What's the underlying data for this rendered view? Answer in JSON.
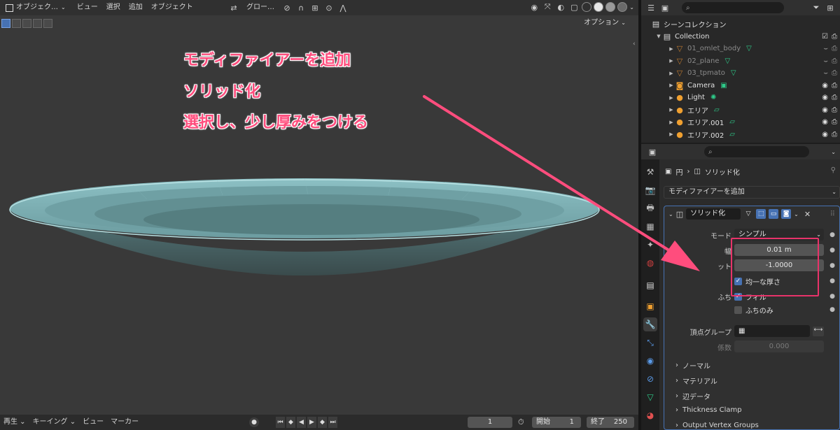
{
  "viewport": {
    "header": {
      "mode": "オブジェク…",
      "menu": [
        "ビュー",
        "選択",
        "追加",
        "オブジェクト"
      ],
      "transform": "グロー…"
    },
    "options": "オプション",
    "annotations": [
      "モディファイアーを追加",
      "ソリッド化",
      "選択し、少し厚みをつける"
    ]
  },
  "timeline": {
    "playback": "再生",
    "keying": "キーイング",
    "view": "ビュー",
    "marker": "マーカー",
    "current_frame": "1",
    "start_label": "開始",
    "start": "1",
    "end_label": "終了",
    "end": "250"
  },
  "outliner": {
    "scene_collection": "シーンコレクション",
    "collection": "Collection",
    "items": [
      {
        "name": "01_omlet_body",
        "dim": true
      },
      {
        "name": "02_plane",
        "dim": true
      },
      {
        "name": "03_tpmato",
        "dim": true
      },
      {
        "name": "Camera",
        "dim": false
      },
      {
        "name": "Light",
        "dim": false
      },
      {
        "name": "エリア",
        "dim": false
      },
      {
        "name": "エリア.001",
        "dim": false
      },
      {
        "name": "エリア.002",
        "dim": false
      }
    ]
  },
  "properties": {
    "breadcrumb_object": "円",
    "breadcrumb_modifier": "ソリッド化",
    "add_modifier": "モディファイアーを追加",
    "modifier": {
      "name": "ソリッド化",
      "mode_label": "モード",
      "mode_value": "シンプル",
      "width_label": "幅",
      "width_value": "0.01 m",
      "offset_label": "ット",
      "offset_value": "-1.0000",
      "even_thickness": "均一な厚さ",
      "rim_label": "ふち",
      "fill": "フィル",
      "rim_only": "ふちのみ",
      "vgroup_label": "頂点グループ",
      "factor_label": "係数",
      "factor_value": "0.000"
    },
    "subpanels": [
      "ノーマル",
      "マテリアル",
      "辺データ",
      "Thickness Clamp",
      "Output Vertex Groups"
    ]
  },
  "colors": {
    "accent": "#4772b3",
    "annotation": "#ff4d7d",
    "highlight_box": "#e8336a",
    "plate": "#7fb3b8"
  }
}
